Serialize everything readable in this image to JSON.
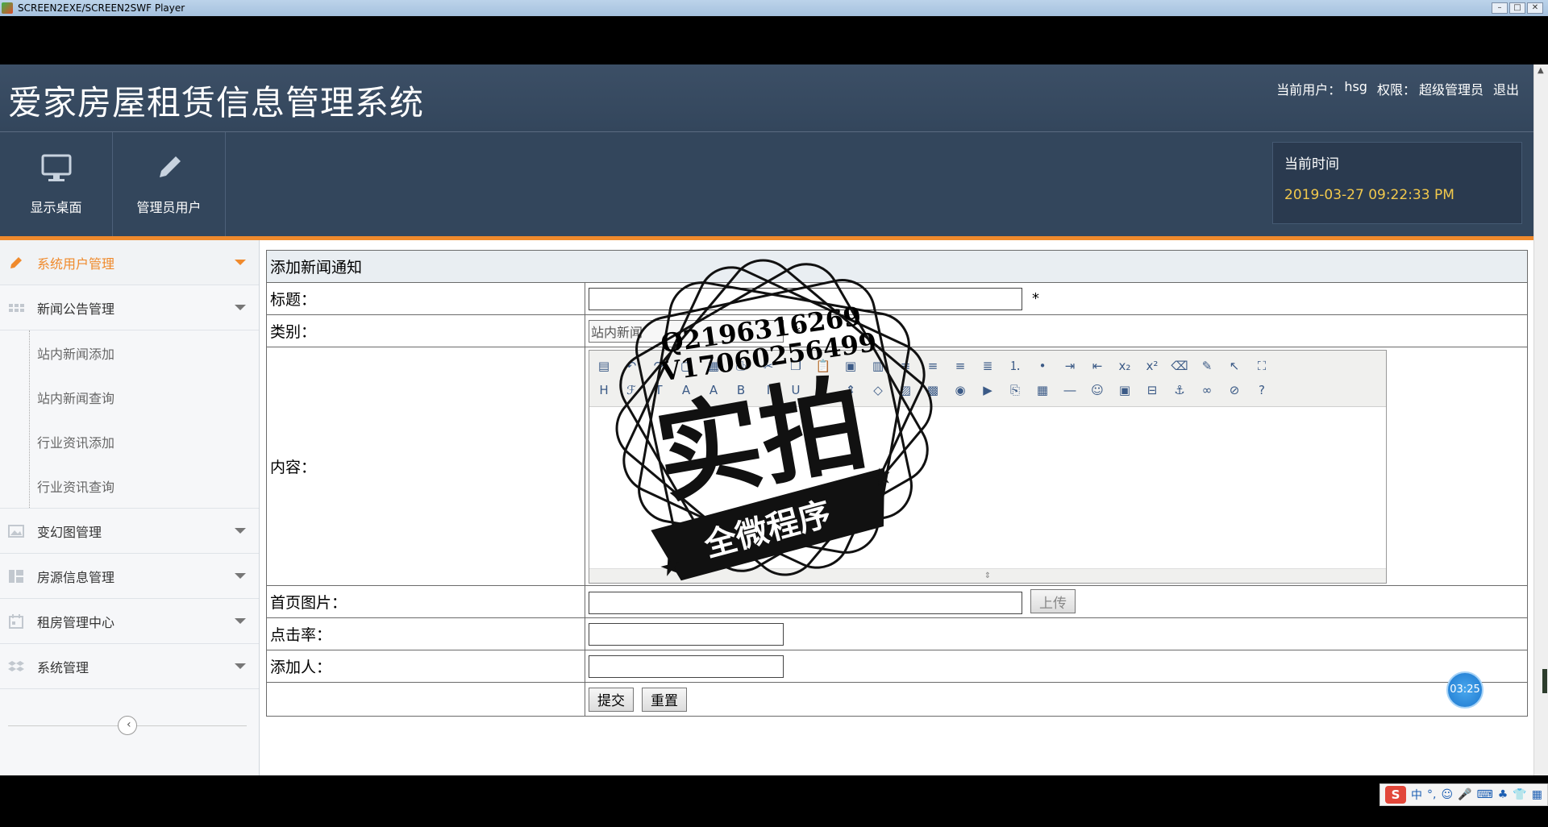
{
  "player": {
    "title": "SCREEN2EXE/SCREEN2SWF Player",
    "buttons": [
      "–",
      "□",
      "✕"
    ]
  },
  "header": {
    "system_title": "爱家房屋租赁信息管理系统",
    "current_user_label": "当前用户：",
    "current_user": "hsg",
    "role_label": "权限：",
    "role": "超级管理员",
    "logout": "退出"
  },
  "toolbar": {
    "desktop_label": "显示桌面",
    "admin_user_label": "管理员用户",
    "time_label": "当前时间",
    "time_value": "2019-03-27 09:22:33 PM"
  },
  "sidebar": {
    "groups": [
      {
        "label": "系统用户管理"
      },
      {
        "label": "新闻公告管理"
      },
      {
        "label": "变幻图管理"
      },
      {
        "label": "房源信息管理"
      },
      {
        "label": "租房管理中心"
      },
      {
        "label": "系统管理"
      }
    ],
    "news_subitems": [
      {
        "label": "站内新闻添加"
      },
      {
        "label": "站内新闻查询"
      },
      {
        "label": "行业资讯添加"
      },
      {
        "label": "行业资讯查询"
      }
    ],
    "collapse_icon": "‹"
  },
  "form": {
    "heading": "添加新闻通知",
    "title_label": "标题：",
    "title_value": "",
    "required_mark": "*",
    "category_label": "类别：",
    "category_value": "站内新闻",
    "content_label": "内容：",
    "image_label": "首页图片：",
    "image_value": "",
    "upload_button": "上传",
    "clicks_label": "点击率：",
    "clicks_value": "",
    "adder_label": "添加人：",
    "adder_value": "",
    "submit_button": "提交",
    "reset_button": "重置"
  },
  "watermark": {
    "line1": "Q2196316269",
    "line2": "V17060256499",
    "big_text": "实拍",
    "banner": "全微程序"
  },
  "timer": "03:25",
  "ime": {
    "logo": "S",
    "items": [
      "中",
      "°,",
      "☺",
      "🎤",
      "⌨",
      "♣",
      "👕",
      "▦"
    ]
  }
}
